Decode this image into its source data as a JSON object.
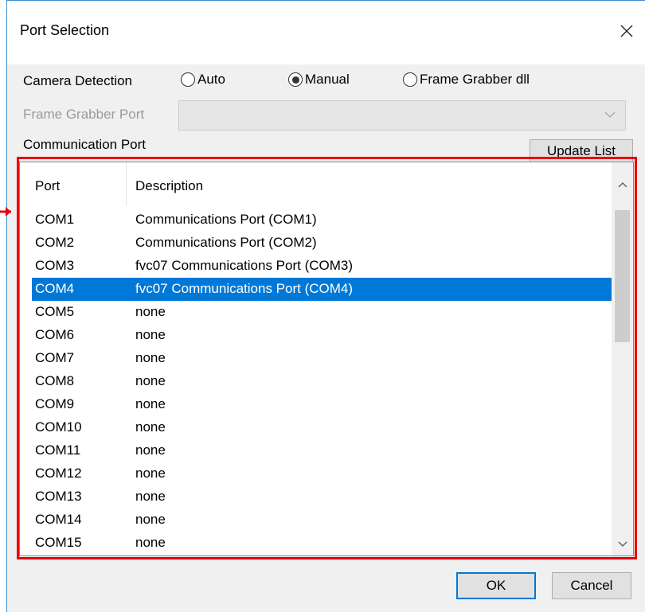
{
  "window": {
    "title": "Port Selection",
    "close_icon": "close-icon"
  },
  "camera_detection": {
    "label": "Camera Detection",
    "options": [
      {
        "label": "Auto",
        "selected": false
      },
      {
        "label": "Manual",
        "selected": true
      },
      {
        "label": "Frame Grabber dll",
        "selected": false
      }
    ]
  },
  "frame_grabber_port": {
    "label": "Frame Grabber Port",
    "value": "",
    "disabled": true
  },
  "communication_port": {
    "label": "Communication Port",
    "update_button": "Update List"
  },
  "port_list": {
    "headers": [
      "Port",
      "Description"
    ],
    "selected_index": 3,
    "rows": [
      {
        "port": "COM1",
        "description": "Communications Port (COM1)"
      },
      {
        "port": "COM2",
        "description": "Communications Port (COM2)"
      },
      {
        "port": "COM3",
        "description": "fvc07 Communications Port (COM3)"
      },
      {
        "port": "COM4",
        "description": "fvc07 Communications Port (COM4)"
      },
      {
        "port": "COM5",
        "description": "none"
      },
      {
        "port": "COM6",
        "description": "none"
      },
      {
        "port": "COM7",
        "description": "none"
      },
      {
        "port": "COM8",
        "description": "none"
      },
      {
        "port": "COM9",
        "description": "none"
      },
      {
        "port": "COM10",
        "description": "none"
      },
      {
        "port": "COM11",
        "description": "none"
      },
      {
        "port": "COM12",
        "description": "none"
      },
      {
        "port": "COM13",
        "description": "none"
      },
      {
        "port": "COM14",
        "description": "none"
      },
      {
        "port": "COM15",
        "description": "none"
      }
    ]
  },
  "footer": {
    "ok": "OK",
    "cancel": "Cancel"
  },
  "colors": {
    "selection": "#0078d7",
    "annotation": "#e8000b",
    "dialog_bg": "#f0f0f0"
  }
}
